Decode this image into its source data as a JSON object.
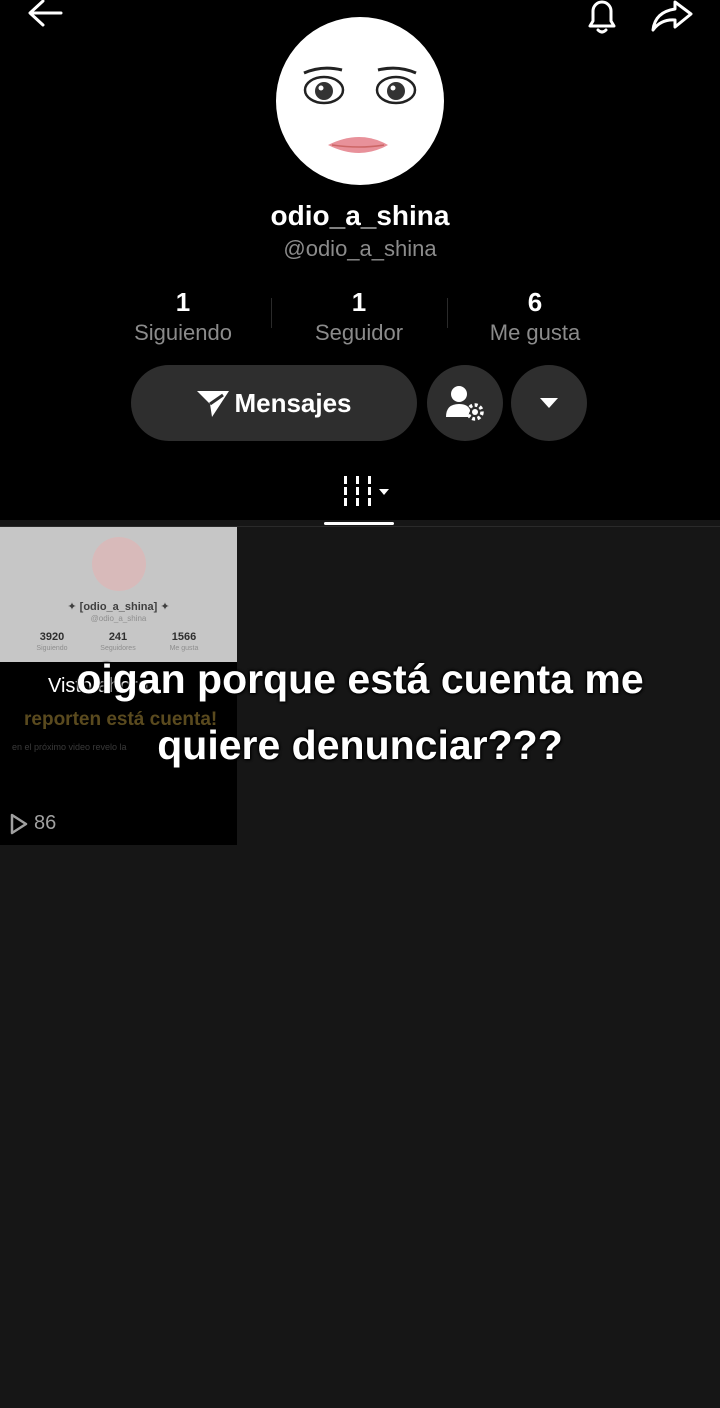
{
  "profile": {
    "display_name": "odio_a_shina",
    "handle": "@odio_a_shina"
  },
  "stats": [
    {
      "value": "1",
      "label": "Siguiendo"
    },
    {
      "value": "1",
      "label": "Seguidor"
    },
    {
      "value": "6",
      "label": "Me gusta"
    }
  ],
  "actions": {
    "message_label": "Mensajes"
  },
  "video": {
    "views": "86",
    "thumb": {
      "name": "✦ [odio_a_shina] ✦",
      "handle": "@odio_a_shina",
      "stats": [
        "3920",
        "241",
        "1566"
      ],
      "stat_labels": [
        "Siguiendo",
        "Seguidores",
        "Me gusta"
      ],
      "seen_label": "Visto ahora",
      "headline": "reporten está cuenta!",
      "sub": "en el próximo video revelo la"
    }
  },
  "overlay": {
    "line1": "oigan porque está cuenta me",
    "line2": "quiere denunciar???"
  },
  "icons": [
    "back-arrow-icon",
    "bell-icon",
    "share-icon",
    "send-icon",
    "user-settings-icon",
    "dropdown-icon",
    "grid-icon",
    "play-icon"
  ]
}
